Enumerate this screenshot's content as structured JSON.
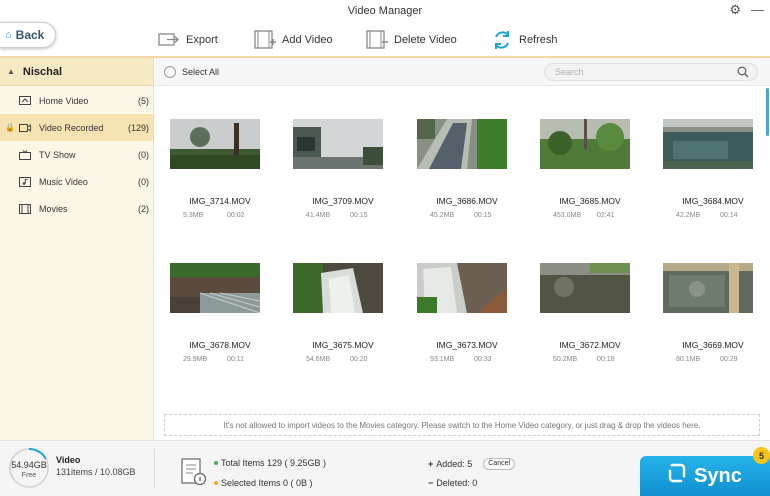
{
  "window": {
    "title": "Video Manager"
  },
  "toolbar": {
    "back_label": "Back",
    "export_label": "Export",
    "add_label": "Add Video",
    "delete_label": "Delete Video",
    "refresh_label": "Refresh"
  },
  "sidebar": {
    "device_name": "Nischal",
    "items": [
      {
        "label": "Home Video",
        "count": "(5)",
        "icon": "home-video-icon"
      },
      {
        "label": "Video Recorded",
        "count": "(129)",
        "icon": "video-recorded-icon"
      },
      {
        "label": "TV Show",
        "count": "(0)",
        "icon": "tv-icon"
      },
      {
        "label": "Music Video",
        "count": "(0)",
        "icon": "music-video-icon"
      },
      {
        "label": "Movies",
        "count": "(2)",
        "icon": "movies-icon"
      }
    ]
  },
  "main": {
    "select_all_label": "Select All",
    "search_placeholder": "Search",
    "videos": [
      {
        "name": "IMG_3714.MOV",
        "size": "5.3MB",
        "duration": "00:02"
      },
      {
        "name": "IMG_3709.MOV",
        "size": "41.4MB",
        "duration": "00:15"
      },
      {
        "name": "IMG_3686.MOV",
        "size": "45.2MB",
        "duration": "00:15"
      },
      {
        "name": "IMG_3685.MOV",
        "size": "453.0MB",
        "duration": "02:41"
      },
      {
        "name": "IMG_3684.MOV",
        "size": "42.2MB",
        "duration": "00:14"
      },
      {
        "name": "IMG_3678.MOV",
        "size": "29.9MB",
        "duration": "00:11"
      },
      {
        "name": "IMG_3675.MOV",
        "size": "54.6MB",
        "duration": "00:20"
      },
      {
        "name": "IMG_3673.MOV",
        "size": "93.1MB",
        "duration": "00:33"
      },
      {
        "name": "IMG_3672.MOV",
        "size": "50.2MB",
        "duration": "00:18"
      },
      {
        "name": "IMG_3669.MOV",
        "size": "80.1MB",
        "duration": "00:29"
      }
    ],
    "notice": "It's not allowed to  import videos to the Movies category.  Please switch to the Home Video category, or just drag & drop the videos here."
  },
  "status": {
    "free_space": "54.94GB",
    "free_label": "Free",
    "category": "Video",
    "summary": "131items / 10.08GB",
    "total_items": "Total Items 129 ( 9.25GB )",
    "selected_items": "Selected Items 0 ( 0B )",
    "added": "Added:  5",
    "cancel_label": "Cancel",
    "deleted": "Deleted:  0",
    "sync_label": "Sync",
    "sync_badge": "5"
  },
  "colors": {
    "accent": "#1ea4e0",
    "sidebar_bg": "#fdf7e8",
    "sidebar_active": "#f7e3b2",
    "badge": "#f5c518"
  }
}
